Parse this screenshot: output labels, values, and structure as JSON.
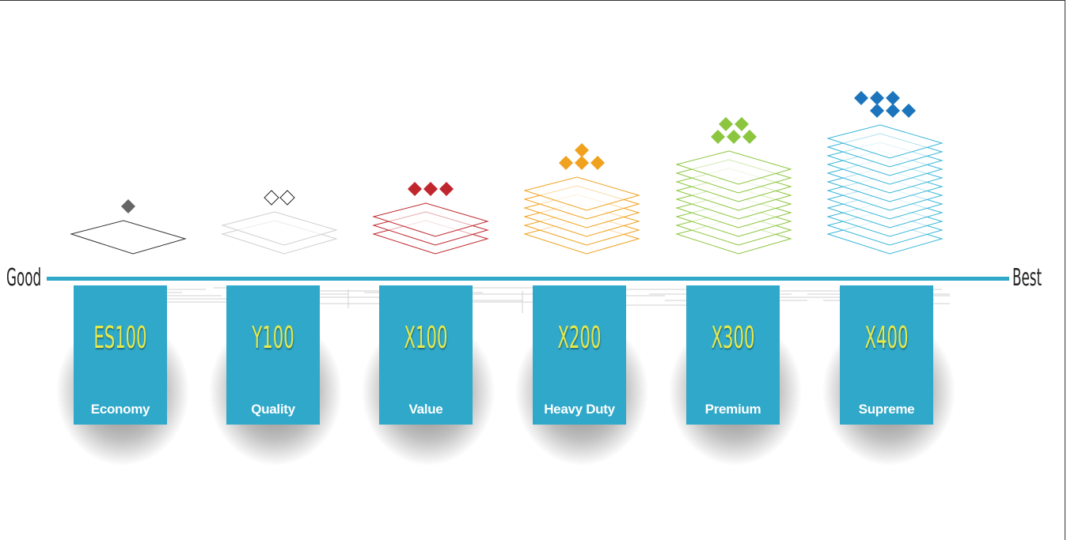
{
  "scale": {
    "left_label": "Good",
    "right_label": "Best",
    "line_color": "#2fa8c9"
  },
  "products": [
    {
      "code": "ES100",
      "name": "Economy",
      "layers": 1,
      "color": "#333333",
      "diamond_color": "#666666",
      "diamonds": 1,
      "diamond_style": "filled"
    },
    {
      "code": "Y100",
      "name": "Quality",
      "layers": 2,
      "color": "#cfcfcf",
      "diamond_color": "#222222",
      "diamonds": 2,
      "diamond_style": "outline"
    },
    {
      "code": "X100",
      "name": "Value",
      "layers": 3,
      "color": "#c0272d",
      "diamond_color": "#c0272d",
      "diamonds": 3,
      "diamond_style": "filled"
    },
    {
      "code": "X200",
      "name": "Heavy Duty",
      "layers": 6,
      "color": "#f0a21e",
      "diamond_color": "#f0a21e",
      "diamonds": 4,
      "diamond_style": "filled"
    },
    {
      "code": "X300",
      "name": "Premium",
      "layers": 9,
      "color": "#8cc63f",
      "diamond_color": "#8cc63f",
      "diamonds": 5,
      "diamond_style": "filled"
    },
    {
      "code": "X400",
      "name": "Supreme",
      "layers": 12,
      "color": "#3bb7d8",
      "diamond_color": "#1c75bc",
      "diamonds": 6,
      "diamond_style": "filled"
    }
  ],
  "tag_color": "#2fa8c9",
  "code_color": "#e6e84a"
}
